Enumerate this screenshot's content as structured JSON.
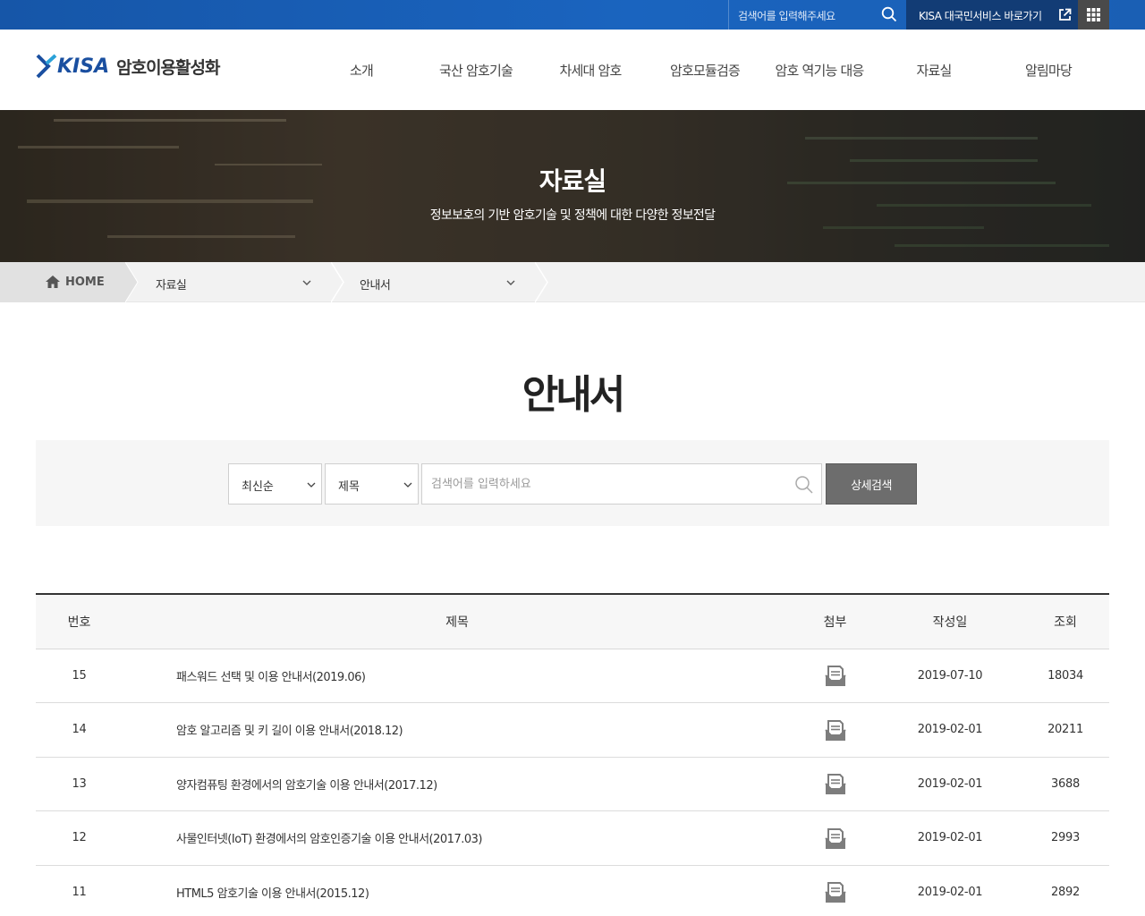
{
  "topbar": {
    "search_placeholder": "검색어를 입력해주세요",
    "external_link_label": "KISA 대국민서비스 바로가기"
  },
  "logo": {
    "brand": "KISA",
    "subtitle": "암호이용활성화"
  },
  "nav": {
    "items": [
      {
        "label": "소개"
      },
      {
        "label": "국산 암호기술"
      },
      {
        "label": "차세대 암호"
      },
      {
        "label": "암호모듈검증"
      },
      {
        "label": "암호 역기능 대응"
      },
      {
        "label": "자료실"
      },
      {
        "label": "알림마당"
      }
    ]
  },
  "hero": {
    "title": "자료실",
    "subtitle": "정보보호의 기반 암호기술 및 정책에 대한 다양한 정보전달"
  },
  "breadcrumb": {
    "home": "HOME",
    "level1": "자료실",
    "level2": "안내서"
  },
  "page": {
    "title": "안내서"
  },
  "search": {
    "sort_value": "최신순",
    "field_value": "제목",
    "placeholder": "검색어를 입력하세요",
    "detail_button": "상세검색"
  },
  "table": {
    "headers": {
      "no": "번호",
      "title": "제목",
      "attach": "첨부",
      "date": "작성일",
      "views": "조회"
    },
    "rows": [
      {
        "no": "15",
        "title": "패스워드 선택 및 이용 안내서(2019.06)",
        "date": "2019-07-10",
        "views": "18034"
      },
      {
        "no": "14",
        "title": "암호 알고리즘 및 키 길이 이용 안내서(2018.12)",
        "date": "2019-02-01",
        "views": "20211"
      },
      {
        "no": "13",
        "title": "양자컴퓨팅 환경에서의 암호기술 이용 안내서(2017.12)",
        "date": "2019-02-01",
        "views": "3688"
      },
      {
        "no": "12",
        "title": "사물인터넷(IoT) 환경에서의 암호인증기술 이용 안내서(2017.03)",
        "date": "2019-02-01",
        "views": "2993"
      },
      {
        "no": "11",
        "title": "HTML5 암호기술 이용 안내서(2015.12)",
        "date": "2019-02-01",
        "views": "2892"
      }
    ]
  },
  "colors": {
    "topbar_blue": "#1a5fb4",
    "topbar_link_bg": "#123c75",
    "brand_blue": "#1a4fa0",
    "detail_button_bg": "#6d6d6d"
  }
}
